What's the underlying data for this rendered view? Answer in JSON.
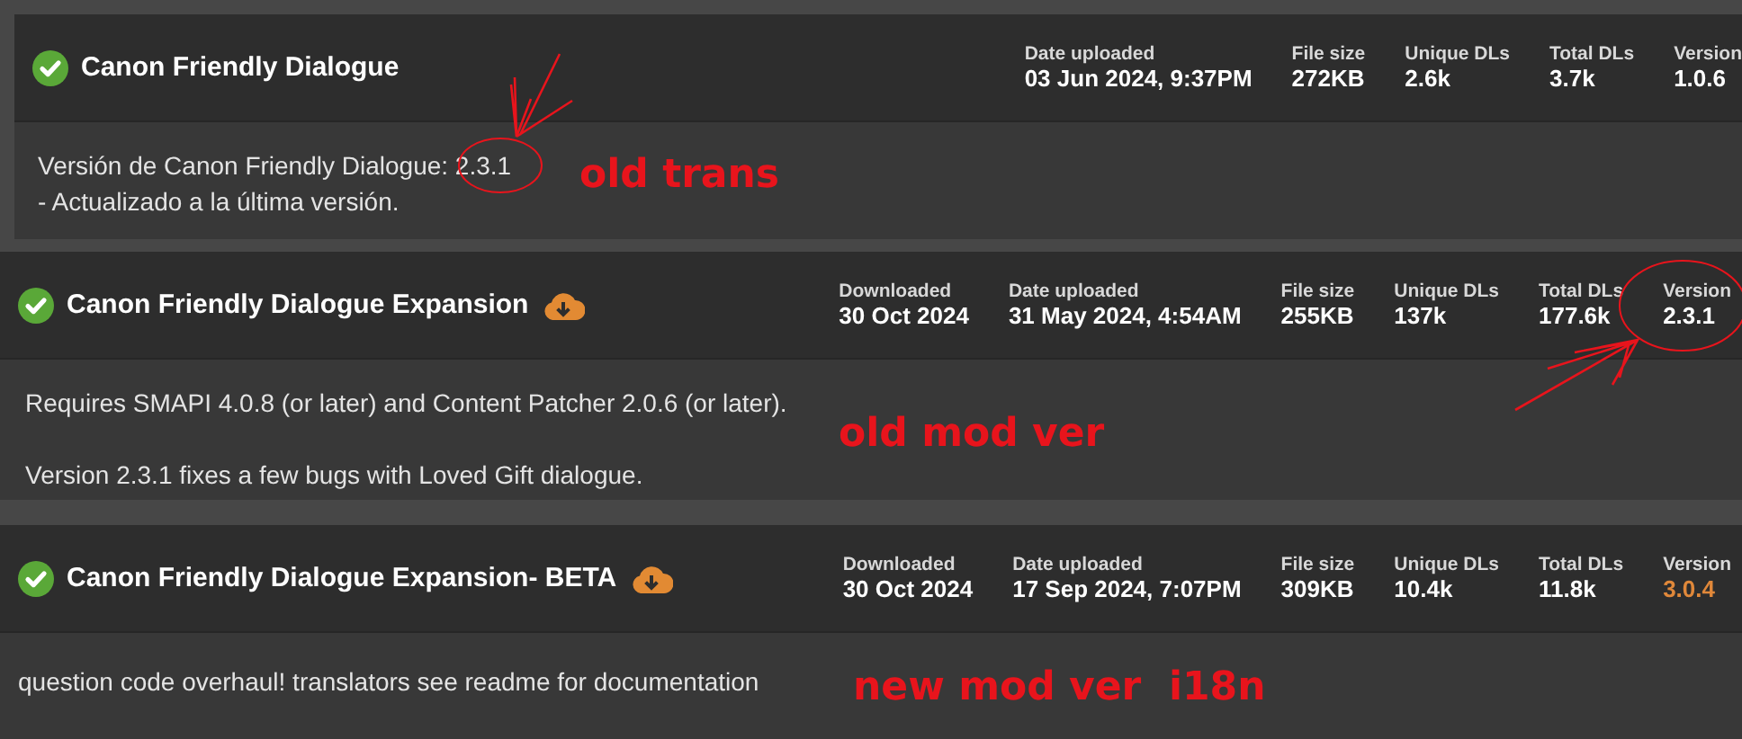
{
  "mods": [
    {
      "title": "Canon Friendly Dialogue",
      "download_icon": false,
      "stats": [
        {
          "label": "Date uploaded",
          "value": "03 Jun 2024, 9:37PM",
          "highlighted": false
        },
        {
          "label": "File size",
          "value": "272KB",
          "highlighted": false
        },
        {
          "label": "Unique DLs",
          "value": "2.6k",
          "highlighted": false
        },
        {
          "label": "Total DLs",
          "value": "3.7k",
          "highlighted": false
        },
        {
          "label": "Version",
          "value": "1.0.6",
          "highlighted": false
        }
      ],
      "paragraphs": [
        [
          "Versión de Canon Friendly Dialogue: 2.3.1",
          "- Actualizado a la última versión."
        ]
      ],
      "annotation": "old trans"
    },
    {
      "title": "Canon Friendly Dialogue Expansion",
      "download_icon": true,
      "stats": [
        {
          "label": "Downloaded",
          "value": "30 Oct 2024",
          "highlighted": false
        },
        {
          "label": "Date uploaded",
          "value": "31 May 2024, 4:54AM",
          "highlighted": false
        },
        {
          "label": "File size",
          "value": "255KB",
          "highlighted": false
        },
        {
          "label": "Unique DLs",
          "value": "137k",
          "highlighted": false
        },
        {
          "label": "Total DLs",
          "value": "177.6k",
          "highlighted": false
        },
        {
          "label": "Version",
          "value": "2.3.1",
          "highlighted": false
        }
      ],
      "paragraphs": [
        [
          "Requires SMAPI 4.0.8 (or later) and Content Patcher 2.0.6 (or later)."
        ],
        [
          "Version 2.3.1 fixes a few bugs with Loved Gift dialogue."
        ]
      ],
      "annotation": "old mod ver"
    },
    {
      "title": "Canon Friendly Dialogue Expansion- BETA",
      "download_icon": true,
      "stats": [
        {
          "label": "Downloaded",
          "value": "30 Oct 2024",
          "highlighted": false
        },
        {
          "label": "Date uploaded",
          "value": "17 Sep 2024, 7:07PM",
          "highlighted": false
        },
        {
          "label": "File size",
          "value": "309KB",
          "highlighted": false
        },
        {
          "label": "Unique DLs",
          "value": "10.4k",
          "highlighted": false
        },
        {
          "label": "Total DLs",
          "value": "11.8k",
          "highlighted": false
        },
        {
          "label": "Version",
          "value": "3.0.4",
          "highlighted": true
        }
      ],
      "paragraphs": [
        [
          "question code overhaul! translators see readme for documentation"
        ]
      ],
      "annotation": "new mod ver  i18n"
    }
  ]
}
